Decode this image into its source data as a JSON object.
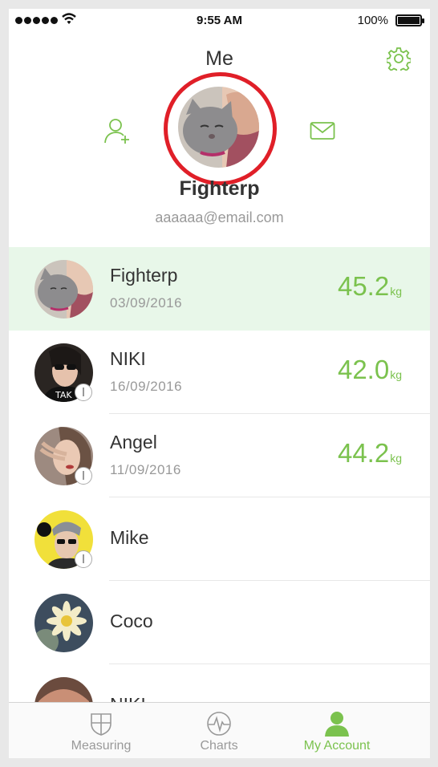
{
  "status_bar": {
    "time": "9:55 AM",
    "battery": "100%"
  },
  "header": {
    "title": "Me"
  },
  "profile": {
    "name": "Fighterp",
    "email": "aaaaaa@email.com"
  },
  "members": [
    {
      "name": "Fighterp",
      "date": "03/09/2016",
      "weight": "45.2",
      "unit": "kg",
      "active": true
    },
    {
      "name": "NIKI",
      "date": "16/09/2016",
      "weight": "42.0",
      "unit": "kg"
    },
    {
      "name": "Angel",
      "date": "11/09/2016",
      "weight": "44.2",
      "unit": "kg"
    },
    {
      "name": "Mike"
    },
    {
      "name": "Coco"
    },
    {
      "name": "NIKI"
    }
  ],
  "tabs": [
    {
      "label": "Measuring",
      "icon": "shield-icon"
    },
    {
      "label": "Charts",
      "icon": "pulse-icon"
    },
    {
      "label": "My Account",
      "icon": "person-icon",
      "active": true
    }
  ],
  "colors": {
    "accent": "#7bc24e",
    "highlight_ring": "#e01f28",
    "active_row": "#e8f7e9"
  }
}
